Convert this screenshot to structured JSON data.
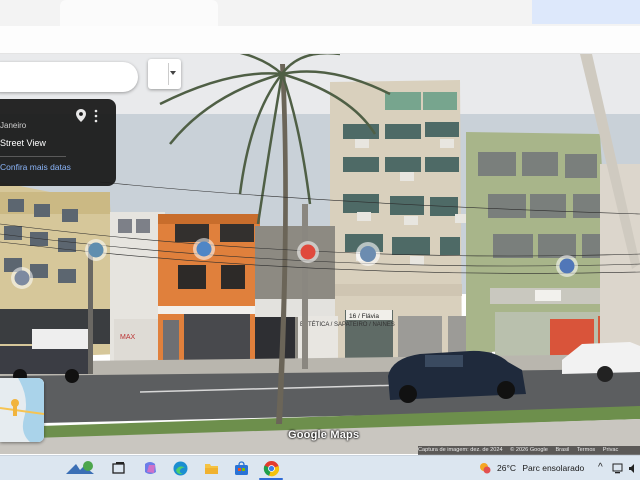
{
  "info_panel": {
    "location": "Janeiro",
    "street_view_label": "Street View",
    "date_link": "Confira mais datas",
    "pin_icon": "location-pin-icon",
    "more_icon": "more-vert-icon"
  },
  "search": {
    "value": ""
  },
  "watermark": "Google Maps",
  "attribution": {
    "capture": "Captura de imagem: dez. de 2024",
    "copyright": "© 2026 Google",
    "country": "Brasil",
    "terms": "Termos",
    "privacy": "Privac"
  },
  "building_signs": {
    "sign1": "16 / Flávia",
    "sign2": "ESTÉTICA / SAPATEIRO / NAINES"
  },
  "taskbar": {
    "weather_temp": "26°C",
    "weather_desc": "Parc ensolarado",
    "icons": [
      "widgets-icon",
      "taskview-icon",
      "copilot-icon",
      "edge-icon",
      "file-explorer-icon",
      "store-icon",
      "chrome-icon"
    ],
    "tray_chevron": "^"
  },
  "colors": {
    "sky": "#c9d1d8",
    "road": "#5c5e60",
    "orange_building": "#e0803c",
    "green_building": "#a8b58a",
    "cream_building": "#d9d0bd",
    "taskbar": "#dce6f0",
    "info_panel": "#1a1a1a",
    "link": "#8ab4f8"
  }
}
